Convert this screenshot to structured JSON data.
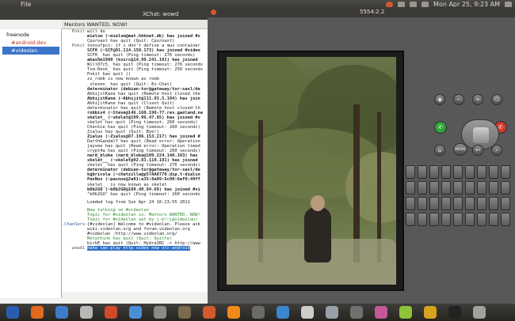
{
  "top_panel": {
    "menu_file": "File",
    "clock": "Mon Apr 25, 9:23 AM"
  },
  "xchat": {
    "window_title": "XChat: wowd",
    "topic": "Mentors WANTED, NOW!",
    "network": "freenode",
    "channels": [
      "#android-dev",
      "#videolan"
    ],
    "input_nick": "wowd1",
    "log": [
      {
        "nick": "Pokit",
        "text": "will do",
        "style": ""
      },
      {
        "nick": "",
        "text": "mielsm (~mielsm@mat.hhknet.dk) has joined #v",
        "style": "bold"
      },
      {
        "nick": "",
        "text": "Cpuroast has quit (Quit: Cpuroast)",
        "style": ""
      },
      {
        "nick": "Pokit",
        "text": "tonsofpcs: if i don't define a mux container",
        "style": ""
      },
      {
        "nick": "",
        "text": "SCF0 (~SCF@91.114.150.173) has joined #video",
        "style": "bold"
      },
      {
        "nick": "",
        "text": "SCF0_ has quit (Ping timeout: 276 seconds)",
        "style": ""
      },
      {
        "nick": "",
        "text": "akashm1990 (kvirc@14.99.241.101) has joined",
        "style": "bold"
      },
      {
        "nick": "",
        "text": "Will07c5_ has quit (Ping timeout: 276 seconds",
        "style": ""
      },
      {
        "nick": "",
        "text": "Tim-Desk_ has quit (Ping timeout: 250 seconds",
        "style": ""
      },
      {
        "nick": "",
        "text": "Pokit has quit ()",
        "style": ""
      },
      {
        "nick": "",
        "text": "zz_romb is now known as romb",
        "style": ""
      },
      {
        "nick": "",
        "text": "_steven_ has quit (Quit: Ex-Chat)",
        "style": ""
      },
      {
        "nick": "",
        "text": "determinator (debian-tor@gateway/tor-sasl/de",
        "style": "bold"
      },
      {
        "nick": "",
        "text": "AbhijitKane has quit (Remote host closed the",
        "style": ""
      },
      {
        "nick": "",
        "text": "AbhijitKane (~Abhijit@111.93.5.194) has join",
        "style": "bold"
      },
      {
        "nick": "",
        "text": "AbhijitKane has quit (Client Quit)",
        "style": ""
      },
      {
        "nick": "",
        "text": "determinator has quit (Remote host closed th",
        "style": ""
      },
      {
        "nick": "",
        "text": "robbiv4 (~Steve@146.160.198-77.rev.gaoland.ne",
        "style": "bold"
      },
      {
        "nick": "",
        "text": "skelet_ (~skelet@109.96.47.65) has joined #v",
        "style": "bold"
      },
      {
        "nick": "",
        "text": "skelet has quit (Ping timeout: 260 seconds)",
        "style": ""
      },
      {
        "nick": "",
        "text": "Checkie has quit (Ping timeout: 260 seconds)",
        "style": ""
      },
      {
        "nick": "",
        "text": "Zialus has quit (Quit: Bye!)",
        "style": ""
      },
      {
        "nick": "",
        "text": "Zialus (~Zialus@87.196.153.217) has joined #",
        "style": "bold"
      },
      {
        "nick": "",
        "text": "DarthGandalf has quit (Read error: Operation",
        "style": ""
      },
      {
        "nick": "",
        "text": "jayvee has quit (Read error: Operation timed",
        "style": ""
      },
      {
        "nick": "",
        "text": "crypt4a has quit (Ping timeout: 260 seconds)",
        "style": ""
      },
      {
        "nick": "",
        "text": "nerd_bloke (nerd_bloke@109.224.140.103) has",
        "style": "bold"
      },
      {
        "nick": "",
        "text": "skelet__ (~skelet@92.83.110.181) has joined",
        "style": "bold"
      },
      {
        "nick": "",
        "text": "skelet_ has quit (Ping timeout: 276 seconds)",
        "style": ""
      },
      {
        "nick": "",
        "text": "determinator (debian-tor@gateway/tor-sasl/de",
        "style": "bold"
      },
      {
        "nick": "",
        "text": "kgbricola (~chatzilla@p57AA8770.dip.t-dialin",
        "style": "bold"
      },
      {
        "nick": "",
        "text": "PasNox (~pasnox@2a01:e35:8a99:6c00:6ef0:49ff",
        "style": "bold"
      },
      {
        "nick": "",
        "text": "skelet__ is now known as skelet",
        "style": ""
      },
      {
        "nick": "",
        "text": "b0b2GO (~b0b2GO@109.40.94.69) has joined #vi",
        "style": "bold"
      },
      {
        "nick": "",
        "text": "\"b0b2GO\" has quit (Ping timeout: 260 seconds",
        "style": ""
      },
      {
        "nick": "",
        "text": "",
        "style": "gap"
      },
      {
        "nick": "",
        "text": "Loaded log from Sun Apr 24 16:23:55 2011",
        "style": ""
      },
      {
        "nick": "",
        "text": "",
        "style": "gap"
      },
      {
        "nick": "",
        "text": "Now talking on #videolan",
        "style": "green"
      },
      {
        "nick": "",
        "text": "Topic for #videolan is: Mentors WANTED, NOW!",
        "style": "green"
      },
      {
        "nick": "",
        "text": "Topic for #videolan set by j-b!~j@videolan/",
        "style": "green"
      },
      {
        "nick": "-ChanServ-",
        "text": "[#videolan] Welcome to #videolan. Please ask",
        "style": "blue"
      },
      {
        "nick": "",
        "text": "wiki.videolan.org and forum.videolan.org",
        "style": ""
      },
      {
        "nick": "",
        "text": "#videolan :http://www.videolan.org/",
        "style": ""
      },
      {
        "nick": "",
        "text": "Metathink has quit (Quit: Quitte)",
        "style": "green"
      },
      {
        "nick": "",
        "text": "birkE has quit (Quit: HydraIRC -> http://www",
        "style": ""
      },
      {
        "nick": "wowd1",
        "text": "haha   can play http video now  vlc-android",
        "style": "hl"
      }
    ]
  },
  "emulator": {
    "window_title": "5554:2.2",
    "menu_key": "MENU",
    "colors": {
      "call_green": "#2fa43a",
      "end_red": "#d03a2a"
    }
  },
  "dock": {
    "icons": [
      "anchor-icon",
      "firefox-icon",
      "globe-icon",
      "media-icon",
      "chrome-icon",
      "browser-icon",
      "settings-icon",
      "folder-icon",
      "ubuntu-icon",
      "vlc-icon",
      "files-icon",
      "windows-icon",
      "document-icon",
      "cd-icon",
      "drive-icon",
      "music-icon",
      "android-icon",
      "star-icon",
      "terminal-icon",
      "monitor-icon"
    ]
  }
}
